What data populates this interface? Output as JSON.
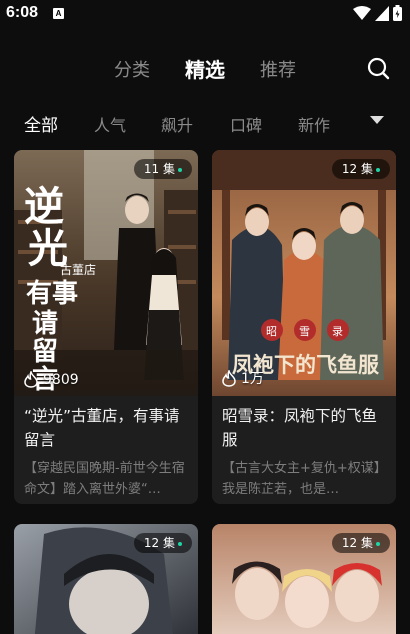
{
  "status": {
    "time": "6:08",
    "app_badge": "A"
  },
  "topnav": {
    "tabs": [
      {
        "label": "分类",
        "active": false
      },
      {
        "label": "精选",
        "active": true
      },
      {
        "label": "推荐",
        "active": false
      }
    ],
    "search_icon": "search-icon"
  },
  "categories": [
    {
      "label": "全部",
      "active": true
    },
    {
      "label": "人气",
      "active": false
    },
    {
      "label": "飙升",
      "active": false
    },
    {
      "label": "口碑",
      "active": false
    },
    {
      "label": "新作",
      "active": false
    }
  ],
  "cards": [
    {
      "episodes": "11 集",
      "heat": "9809",
      "title": "“逆光”古董店，有事请留言",
      "desc": "【穿越民国晚期-前世今生宿命文】踏入离世外婆“…",
      "cover_text": [
        "逆",
        "光",
        "古董店",
        "有事",
        "请",
        "留",
        "言"
      ]
    },
    {
      "episodes": "12 集",
      "heat": "1万",
      "title": "昭雪录：凤袍下的飞鱼服",
      "desc": "【古言大女主+复仇+权谋】我是陈芷若，也是…",
      "cover_text": [
        "昭",
        "雪",
        "录",
        "凤袍下的飞鱼服"
      ]
    },
    {
      "episodes": "12 集"
    },
    {
      "episodes": "12 集"
    }
  ],
  "colors": {
    "background": "#0d0d0d",
    "card": "#1e1e1e",
    "accent_dot": "#1fd4a5"
  }
}
